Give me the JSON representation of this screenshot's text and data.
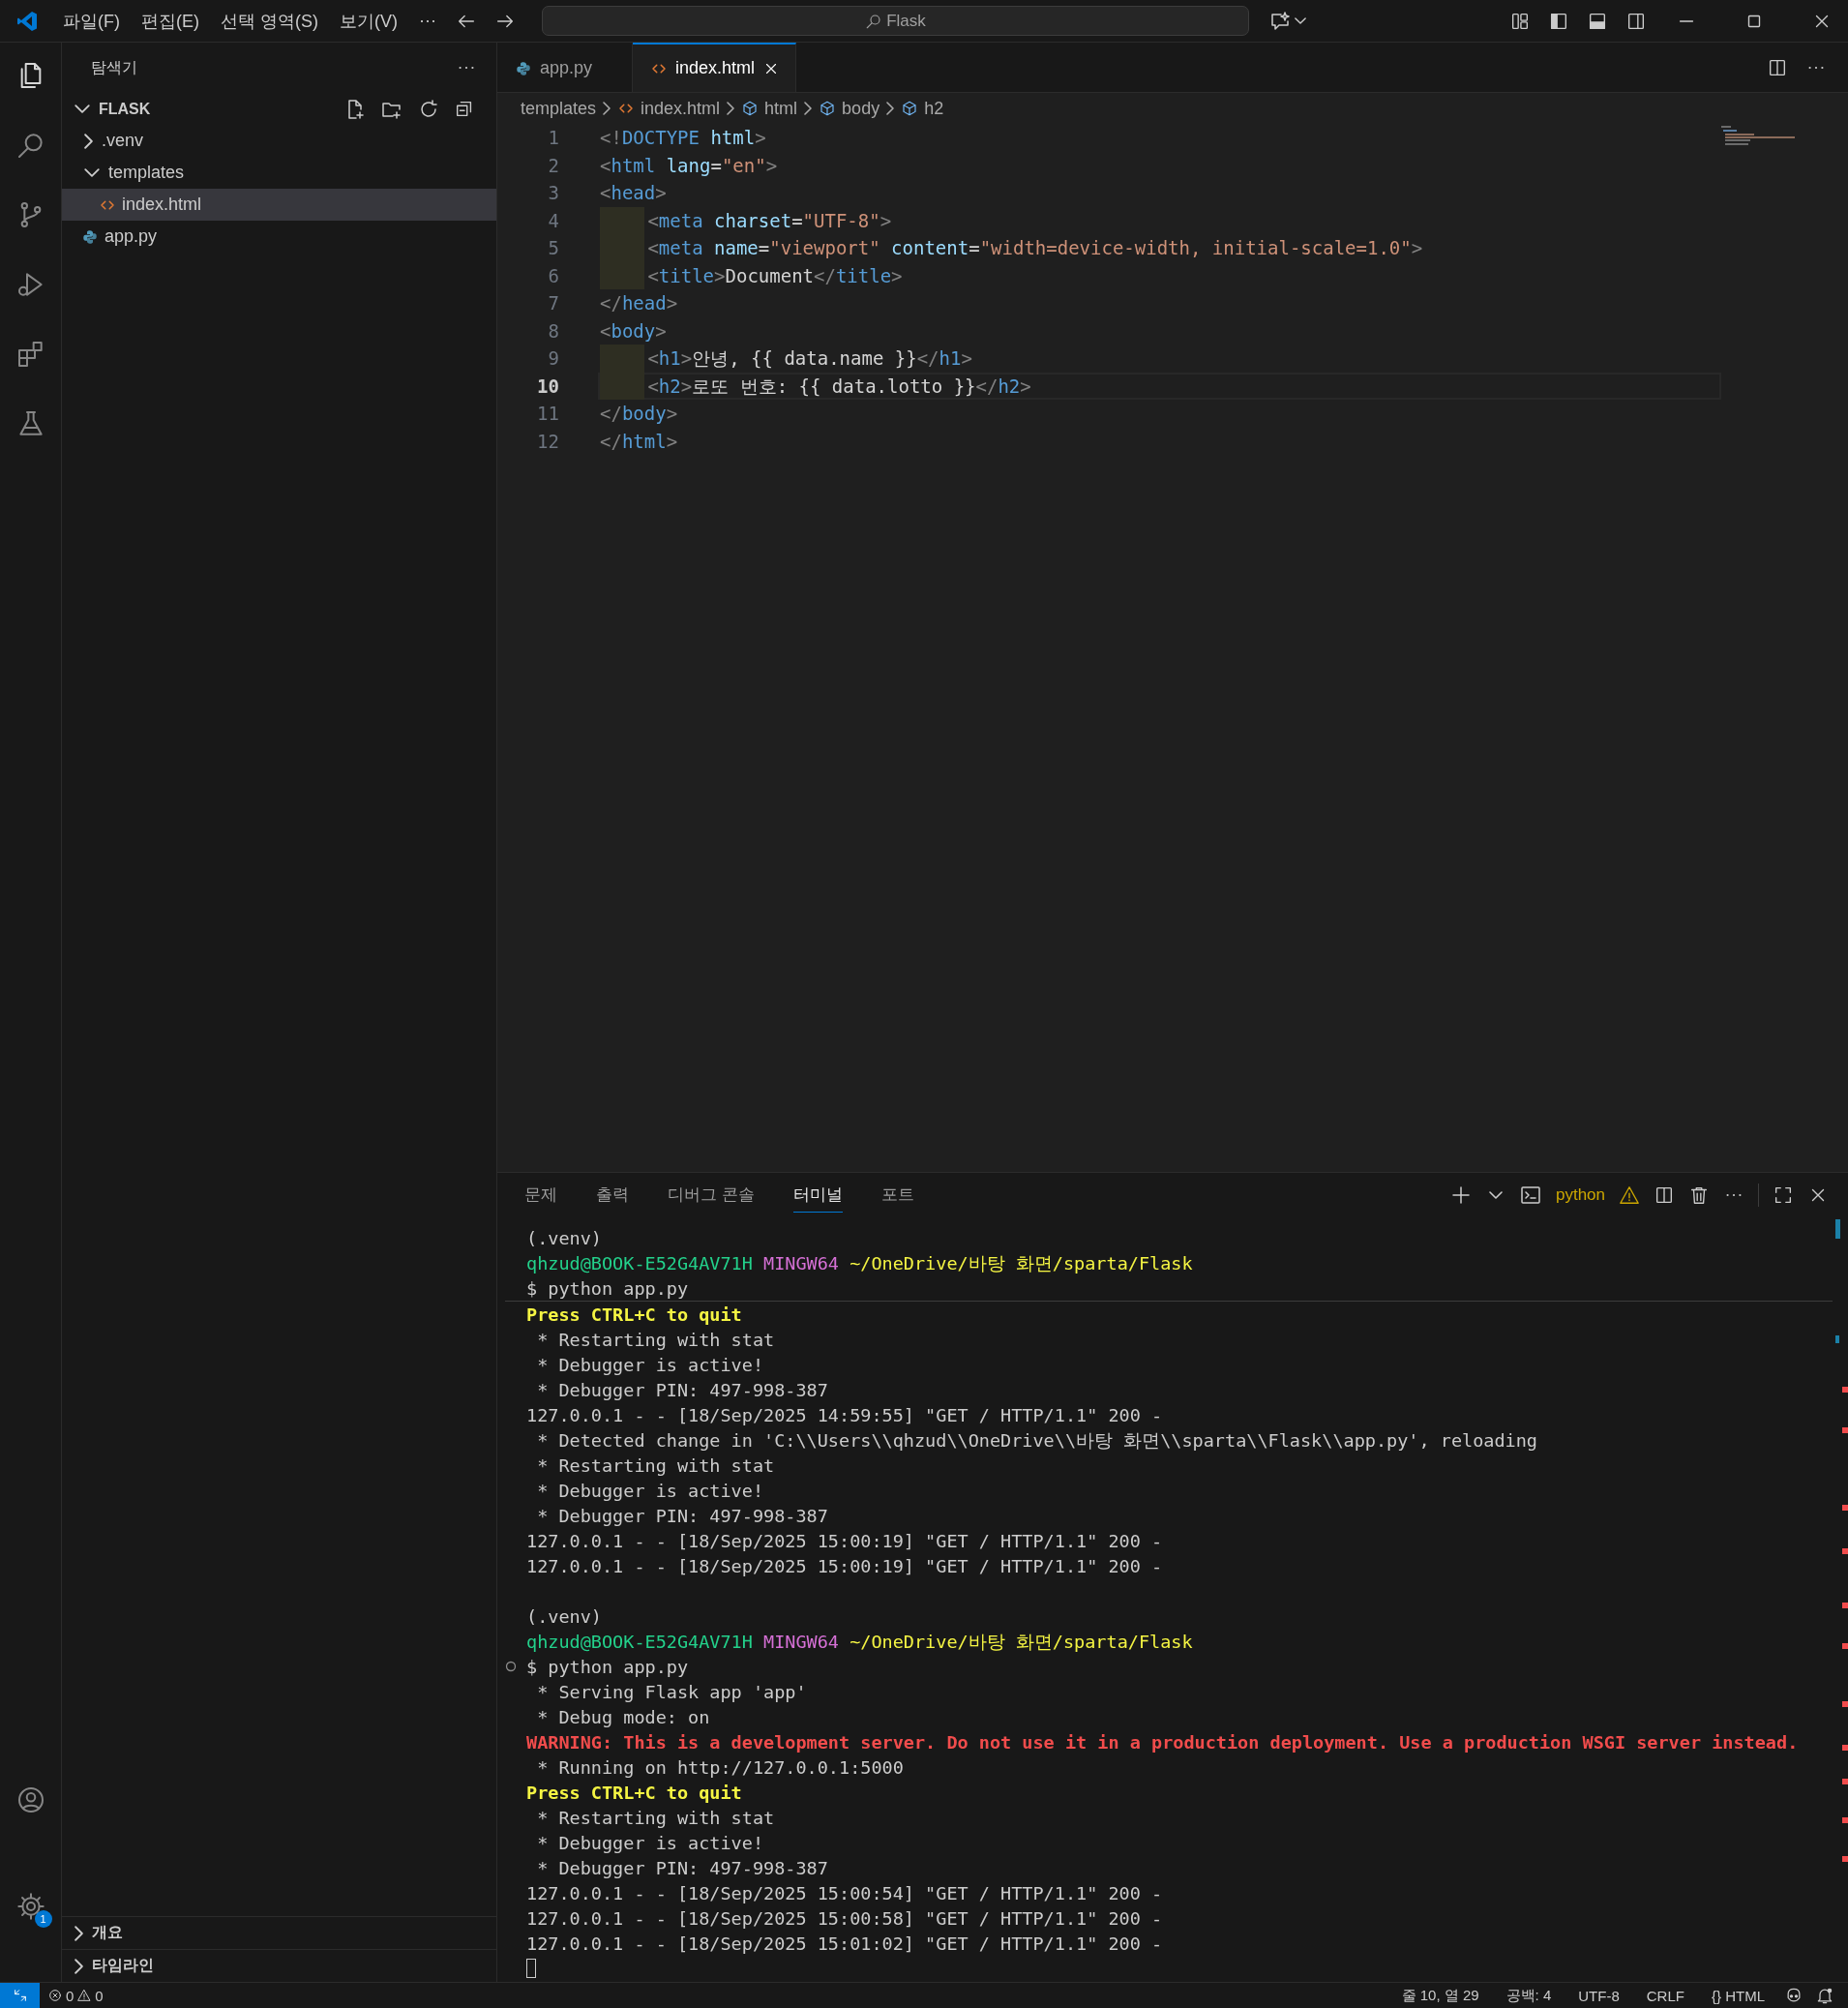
{
  "menu": [
    "파일(F)",
    "편집(E)",
    "선택 영역(S)",
    "보기(V)",
    "···"
  ],
  "command_center": {
    "label": "Flask"
  },
  "sidebar": {
    "title": "탐색기",
    "root": {
      "label": "FLASK",
      "expanded": true
    },
    "tree": [
      {
        "label": ".venv",
        "kind": "folder",
        "expanded": false,
        "selected": false
      },
      {
        "label": "templates",
        "kind": "folder",
        "expanded": true,
        "selected": false,
        "children": [
          {
            "label": "index.html",
            "kind": "html",
            "selected": true
          }
        ]
      },
      {
        "label": "app.py",
        "kind": "python",
        "selected": false
      }
    ],
    "sections": [
      {
        "label": "개요",
        "expanded": false
      },
      {
        "label": "타임라인",
        "expanded": false
      }
    ]
  },
  "tabs": [
    {
      "label": "app.py",
      "kind": "python",
      "selected": false
    },
    {
      "label": "index.html",
      "kind": "html",
      "selected": true
    }
  ],
  "breadcrumbs": [
    {
      "label": "templates",
      "kind": "folder"
    },
    {
      "label": "index.html",
      "kind": "html"
    },
    {
      "label": "html",
      "kind": "element"
    },
    {
      "label": "body",
      "kind": "element"
    },
    {
      "label": "h2",
      "kind": "element"
    }
  ],
  "code": {
    "lines": [
      {
        "number": "1",
        "indented": false,
        "current": false,
        "tokens": [
          {
            "kind": "p",
            "text": "<!"
          },
          {
            "kind": "tag",
            "text": "DOCTYPE"
          },
          {
            "kind": "attr",
            "text": " html"
          },
          {
            "kind": "p",
            "text": ">"
          }
        ]
      },
      {
        "number": "2",
        "indented": false,
        "current": false,
        "tokens": [
          {
            "kind": "p",
            "text": "<"
          },
          {
            "kind": "tag",
            "text": "html"
          },
          {
            "kind": "attr",
            "text": " lang"
          },
          {
            "kind": "plain",
            "text": "="
          },
          {
            "kind": "str",
            "text": "\"en\""
          },
          {
            "kind": "p",
            "text": ">"
          }
        ]
      },
      {
        "number": "3",
        "indented": false,
        "current": false,
        "tokens": [
          {
            "kind": "p",
            "text": "<"
          },
          {
            "kind": "tag",
            "text": "head"
          },
          {
            "kind": "p",
            "text": ">"
          }
        ]
      },
      {
        "number": "4",
        "indented": true,
        "current": false,
        "tokens": [
          {
            "kind": "p",
            "text": "<"
          },
          {
            "kind": "tag",
            "text": "meta"
          },
          {
            "kind": "attr",
            "text": " charset"
          },
          {
            "kind": "plain",
            "text": "="
          },
          {
            "kind": "str",
            "text": "\"UTF-8\""
          },
          {
            "kind": "p",
            "text": ">"
          }
        ]
      },
      {
        "number": "5",
        "indented": true,
        "current": false,
        "tokens": [
          {
            "kind": "p",
            "text": "<"
          },
          {
            "kind": "tag",
            "text": "meta"
          },
          {
            "kind": "attr",
            "text": " name"
          },
          {
            "kind": "plain",
            "text": "="
          },
          {
            "kind": "str",
            "text": "\"viewport\""
          },
          {
            "kind": "attr",
            "text": " content"
          },
          {
            "kind": "plain",
            "text": "="
          },
          {
            "kind": "str",
            "text": "\"width=device-width, initial-scale=1.0\""
          },
          {
            "kind": "p",
            "text": ">"
          }
        ]
      },
      {
        "number": "6",
        "indented": true,
        "current": false,
        "tokens": [
          {
            "kind": "p",
            "text": "<"
          },
          {
            "kind": "tag",
            "text": "title"
          },
          {
            "kind": "p",
            "text": ">"
          },
          {
            "kind": "plain",
            "text": "Document"
          },
          {
            "kind": "p",
            "text": "</"
          },
          {
            "kind": "tag",
            "text": "title"
          },
          {
            "kind": "p",
            "text": ">"
          }
        ]
      },
      {
        "number": "7",
        "indented": false,
        "current": false,
        "tokens": [
          {
            "kind": "p",
            "text": "</"
          },
          {
            "kind": "tag",
            "text": "head"
          },
          {
            "kind": "p",
            "text": ">"
          }
        ]
      },
      {
        "number": "8",
        "indented": false,
        "current": false,
        "tokens": [
          {
            "kind": "p",
            "text": "<"
          },
          {
            "kind": "tag",
            "text": "body"
          },
          {
            "kind": "p",
            "text": ">"
          }
        ]
      },
      {
        "number": "9",
        "indented": true,
        "current": false,
        "tokens": [
          {
            "kind": "p",
            "text": "<"
          },
          {
            "kind": "tag",
            "text": "h1"
          },
          {
            "kind": "p",
            "text": ">"
          },
          {
            "kind": "plain",
            "text": "안녕, {{ data.name }}"
          },
          {
            "kind": "p",
            "text": "</"
          },
          {
            "kind": "tag",
            "text": "h1"
          },
          {
            "kind": "p",
            "text": ">"
          }
        ]
      },
      {
        "number": "10",
        "indented": true,
        "current": true,
        "tokens": [
          {
            "kind": "p",
            "text": "<"
          },
          {
            "kind": "tag",
            "text": "h2"
          },
          {
            "kind": "p",
            "text": ">"
          },
          {
            "kind": "plain",
            "text": "로또 번호: {{ data.lotto }}"
          },
          {
            "kind": "p",
            "text": "</"
          },
          {
            "kind": "tag",
            "text": "h2"
          },
          {
            "kind": "p",
            "text": ">"
          }
        ]
      },
      {
        "number": "11",
        "indented": false,
        "current": false,
        "tokens": [
          {
            "kind": "p",
            "text": "</"
          },
          {
            "kind": "tag",
            "text": "body"
          },
          {
            "kind": "p",
            "text": ">"
          }
        ]
      },
      {
        "number": "12",
        "indented": false,
        "current": false,
        "tokens": [
          {
            "kind": "p",
            "text": "</"
          },
          {
            "kind": "tag",
            "text": "html"
          },
          {
            "kind": "p",
            "text": ">"
          }
        ]
      }
    ]
  },
  "panel": {
    "tabs": [
      {
        "label": "문제",
        "selected": false
      },
      {
        "label": "출력",
        "selected": false
      },
      {
        "label": "디버그 콘솔",
        "selected": false
      },
      {
        "label": "터미널",
        "selected": true
      },
      {
        "label": "포트",
        "selected": false
      }
    ],
    "profile": "python",
    "terminal": {
      "cursor": true,
      "sessions": [
        {
          "lines": [
            {
              "decorated": false,
              "separator": false,
              "segments": [
                {
                  "kind": "plain",
                  "text": "(.venv)"
                }
              ]
            },
            {
              "decorated": false,
              "separator": false,
              "segments": [
                {
                  "kind": "user",
                  "text": "qhzud@BOOK-E52G4AV71H"
                },
                {
                  "kind": "host",
                  "text": " MINGW64"
                },
                {
                  "kind": "path",
                  "text": " ~/OneDrive/바탕 화면/sparta/Flask"
                }
              ]
            },
            {
              "decorated": false,
              "separator": true,
              "segments": [
                {
                  "kind": "plain",
                  "text": "$ python app.py"
                }
              ]
            },
            {
              "decorated": false,
              "separator": false,
              "segments": [
                {
                  "kind": "notice",
                  "text": "Press CTRL+C to quit"
                }
              ]
            },
            {
              "decorated": false,
              "separator": false,
              "segments": [
                {
                  "kind": "plain",
                  "text": " * Restarting with stat"
                }
              ]
            },
            {
              "decorated": false,
              "separator": false,
              "segments": [
                {
                  "kind": "plain",
                  "text": " * Debugger is active!"
                }
              ]
            },
            {
              "decorated": false,
              "separator": false,
              "segments": [
                {
                  "kind": "plain",
                  "text": " * Debugger PIN: 497-998-387"
                }
              ]
            },
            {
              "decorated": false,
              "separator": false,
              "segments": [
                {
                  "kind": "plain",
                  "text": "127.0.0.1 - - [18/Sep/2025 14:59:55] \"GET / HTTP/1.1\" 200 -"
                }
              ]
            },
            {
              "decorated": false,
              "separator": false,
              "segments": [
                {
                  "kind": "plain",
                  "text": " * Detected change in 'C:\\\\Users\\\\qhzud\\\\OneDrive\\\\바탕 화면\\\\sparta\\\\Flask\\\\app.py', reloading"
                }
              ]
            },
            {
              "decorated": false,
              "separator": false,
              "segments": [
                {
                  "kind": "plain",
                  "text": " * Restarting with stat"
                }
              ]
            },
            {
              "decorated": false,
              "separator": false,
              "segments": [
                {
                  "kind": "plain",
                  "text": " * Debugger is active!"
                }
              ]
            },
            {
              "decorated": false,
              "separator": false,
              "segments": [
                {
                  "kind": "plain",
                  "text": " * Debugger PIN: 497-998-387"
                }
              ]
            },
            {
              "decorated": false,
              "separator": false,
              "segments": [
                {
                  "kind": "plain",
                  "text": "127.0.0.1 - - [18/Sep/2025 15:00:19] \"GET / HTTP/1.1\" 200 -"
                }
              ]
            },
            {
              "decorated": false,
              "separator": false,
              "segments": [
                {
                  "kind": "plain",
                  "text": "127.0.0.1 - - [18/Sep/2025 15:00:19] \"GET / HTTP/1.1\" 200 -"
                }
              ]
            }
          ]
        },
        {
          "lines": [
            {
              "decorated": false,
              "separator": false,
              "segments": [
                {
                  "kind": "plain",
                  "text": "(.venv)"
                }
              ]
            },
            {
              "decorated": false,
              "separator": false,
              "segments": [
                {
                  "kind": "user",
                  "text": "qhzud@BOOK-E52G4AV71H"
                },
                {
                  "kind": "host",
                  "text": " MINGW64"
                },
                {
                  "kind": "path",
                  "text": " ~/OneDrive/바탕 화면/sparta/Flask"
                }
              ]
            },
            {
              "decorated": true,
              "separator": false,
              "segments": [
                {
                  "kind": "plain",
                  "text": "$ python app.py"
                }
              ]
            },
            {
              "decorated": false,
              "separator": false,
              "segments": [
                {
                  "kind": "plain",
                  "text": " * Serving Flask app 'app'"
                }
              ]
            },
            {
              "decorated": false,
              "separator": false,
              "segments": [
                {
                  "kind": "plain",
                  "text": " * Debug mode: on"
                }
              ]
            },
            {
              "decorated": false,
              "separator": false,
              "segments": [
                {
                  "kind": "error",
                  "text": "WARNING: This is a development server. Do not use it in a production deployment. Use a production WSGI server instead."
                }
              ]
            },
            {
              "decorated": false,
              "separator": false,
              "segments": [
                {
                  "kind": "plain",
                  "text": " * Running on http://127.0.0.1:5000"
                }
              ]
            },
            {
              "decorated": false,
              "separator": false,
              "segments": [
                {
                  "kind": "notice",
                  "text": "Press CTRL+C to quit"
                }
              ]
            },
            {
              "decorated": false,
              "separator": false,
              "segments": [
                {
                  "kind": "plain",
                  "text": " * Restarting with stat"
                }
              ]
            },
            {
              "decorated": false,
              "separator": false,
              "segments": [
                {
                  "kind": "plain",
                  "text": " * Debugger is active!"
                }
              ]
            },
            {
              "decorated": false,
              "separator": false,
              "segments": [
                {
                  "kind": "plain",
                  "text": " * Debugger PIN: 497-998-387"
                }
              ]
            },
            {
              "decorated": false,
              "separator": false,
              "segments": [
                {
                  "kind": "plain",
                  "text": "127.0.0.1 - - [18/Sep/2025 15:00:54] \"GET / HTTP/1.1\" 200 -"
                }
              ]
            },
            {
              "decorated": false,
              "separator": false,
              "segments": [
                {
                  "kind": "plain",
                  "text": "127.0.0.1 - - [18/Sep/2025 15:00:58] \"GET / HTTP/1.1\" 200 -"
                }
              ]
            },
            {
              "decorated": false,
              "separator": false,
              "segments": [
                {
                  "kind": "plain",
                  "text": "127.0.0.1 - - [18/Sep/2025 15:01:02] \"GET / HTTP/1.1\" 200 -"
                }
              ]
            }
          ]
        }
      ]
    }
  },
  "settings_badge": "1",
  "status_bar": {
    "errors": "0",
    "warnings": "0",
    "position": "줄 10, 열 29",
    "indentation": "공백: 4",
    "encoding": "UTF-8",
    "eol": "CRLF",
    "language_icon": "{}",
    "language": "HTML"
  }
}
